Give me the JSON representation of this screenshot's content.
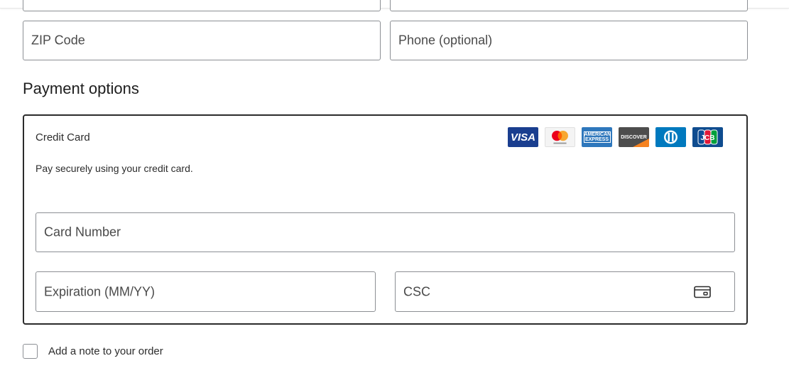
{
  "address": {
    "zip_placeholder": "ZIP Code",
    "phone_placeholder": "Phone (optional)"
  },
  "payment": {
    "heading": "Payment options",
    "method_label": "Credit Card",
    "method_description": "Pay securely using your credit card.",
    "card_brands": [
      "VISA",
      "mastercard",
      "AMERICAN EXPRESS",
      "DISCOVER",
      "Diners Club",
      "JCB"
    ],
    "card_number_placeholder": "Card Number",
    "expiration_placeholder": "Expiration (MM/YY)",
    "csc_placeholder": "CSC",
    "csc_icon": "credit-card-icon"
  },
  "order": {
    "add_note_label": "Add a note to your order"
  }
}
